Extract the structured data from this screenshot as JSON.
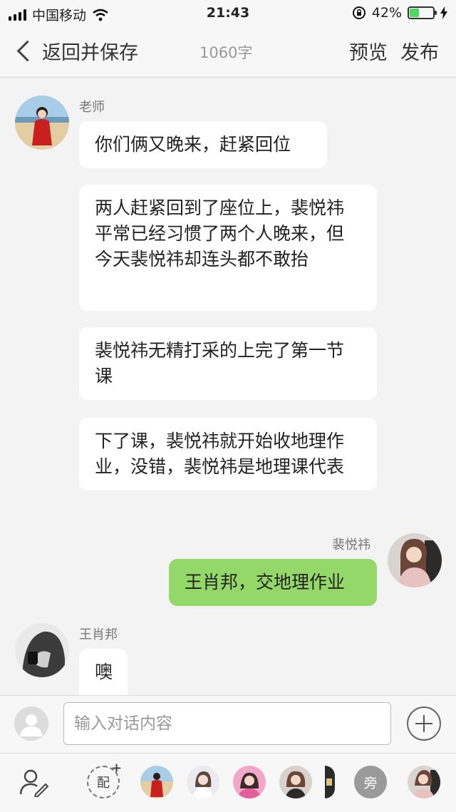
{
  "status": {
    "carrier": "中国移动",
    "time": "21:43",
    "battery_text": "42%",
    "battery_level": 0.42
  },
  "nav": {
    "back_label": "返回并保存",
    "word_count": "1060字",
    "preview_label": "预览",
    "publish_label": "发布"
  },
  "messages": [
    {
      "sender": "老师",
      "text": "你们俩又晚来，赶紧回位"
    },
    {
      "text": "两人赶紧回到了座位上，裴悦祎平常已经习惯了两个人晚来，但今天裴悦祎却连头都不敢抬"
    },
    {
      "text": "裴悦祎无精打采的上完了第一节课"
    },
    {
      "text": "下了课，裴悦祎就开始收地理作业，没错，裴悦祎是地理课代表"
    },
    {
      "sender": "裴悦祎",
      "text": "王肖邦，交地理作业"
    },
    {
      "sender": "王肖邦",
      "text": "噢"
    }
  ],
  "input": {
    "placeholder": "输入对话内容"
  },
  "character_bar": {
    "pei_label": "配",
    "pang_label": "旁"
  },
  "colors": {
    "accent_bubble": "#95d86a",
    "battery_green": "#4cd964"
  }
}
